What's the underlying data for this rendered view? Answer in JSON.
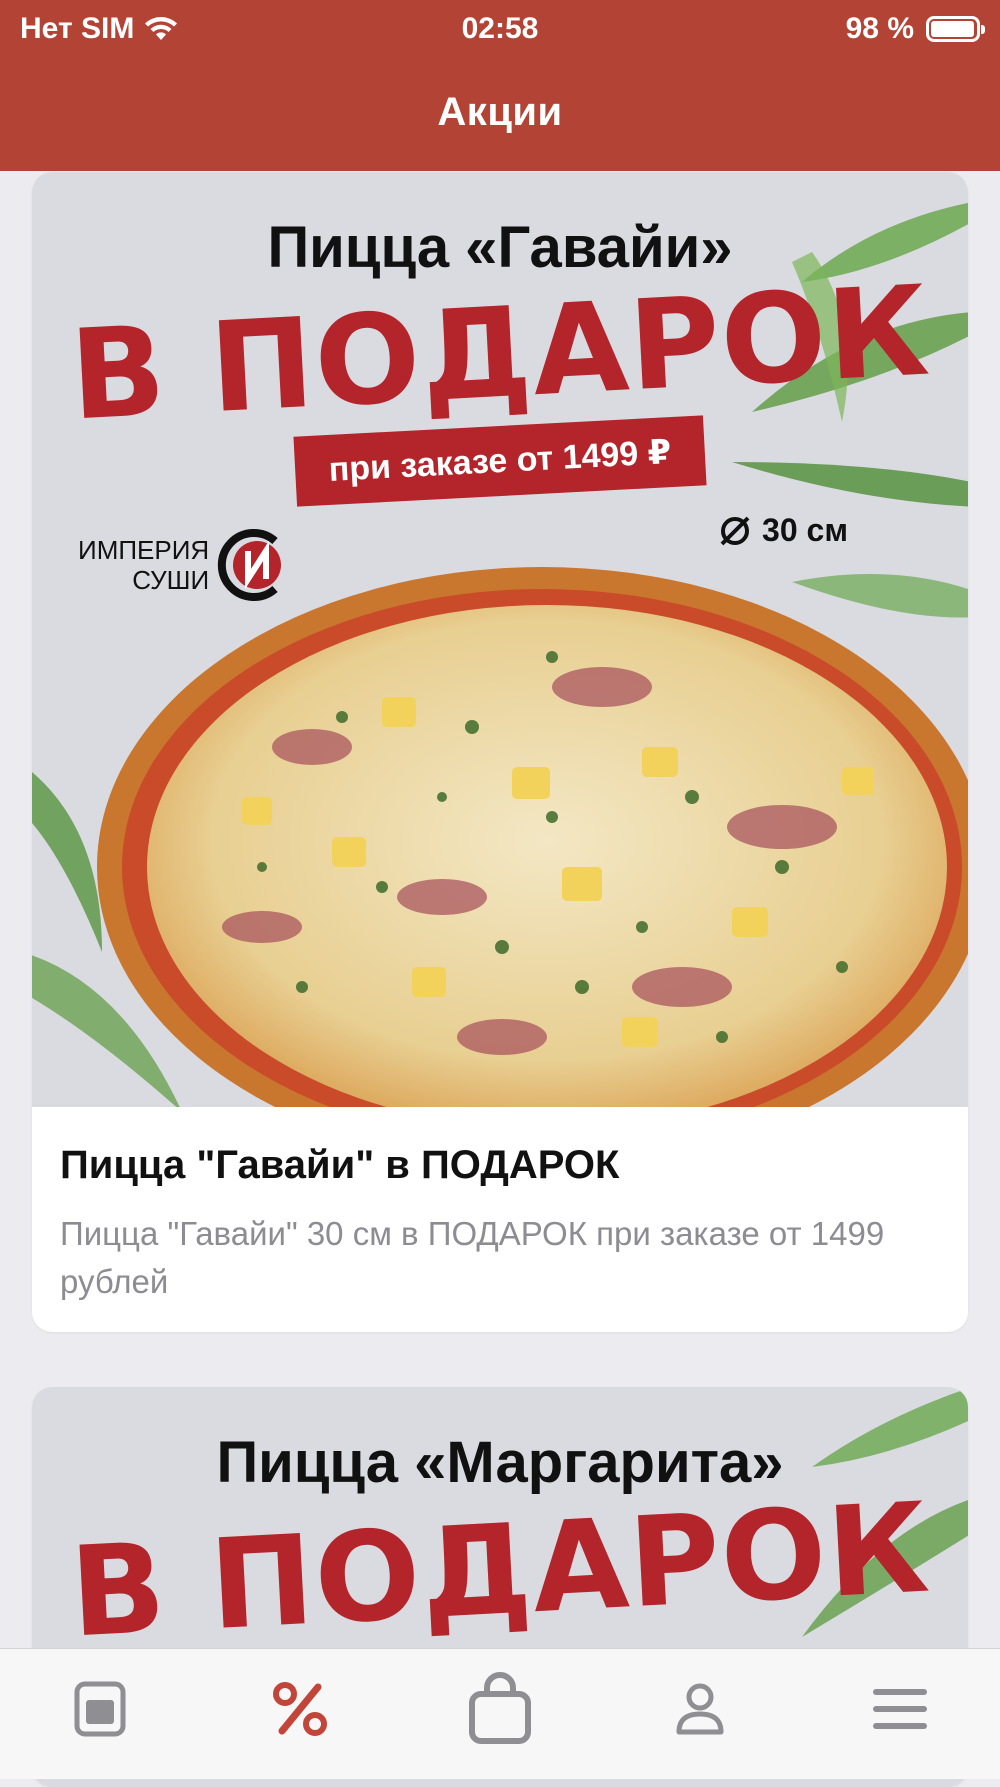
{
  "status_bar": {
    "carrier": "Нет SIM",
    "time": "02:58",
    "battery": "98 %"
  },
  "nav": {
    "title": "Акции"
  },
  "promos": [
    {
      "banner": {
        "title": "Пицца «Гавайи»",
        "headline": "В ПОДАРОК",
        "condition": "при заказе от 1499 ₽",
        "size": "30 см",
        "logo_line1": "ИМПЕРИЯ",
        "logo_line2": "СУШИ"
      },
      "title": "Пицца \"Гавайи\" в ПОДАРОК",
      "description": "Пицца \"Гавайи\" 30 см в ПОДАРОК при заказе от 1499 рублей"
    },
    {
      "banner": {
        "title": "Пицца «Маргарита»",
        "headline": "В ПОДАРОК"
      }
    }
  ],
  "tabbar": {
    "items": [
      {
        "icon": "menu-card-icon",
        "active": false
      },
      {
        "icon": "percent-icon",
        "active": true
      },
      {
        "icon": "shopping-bag-icon",
        "active": false
      },
      {
        "icon": "profile-icon",
        "active": false
      },
      {
        "icon": "hamburger-menu-icon",
        "active": false
      }
    ]
  },
  "colors": {
    "brand": "#b34435",
    "promo_red": "#b3252b",
    "tab_active": "#c2453a",
    "tab_inactive": "#8e8e93"
  }
}
